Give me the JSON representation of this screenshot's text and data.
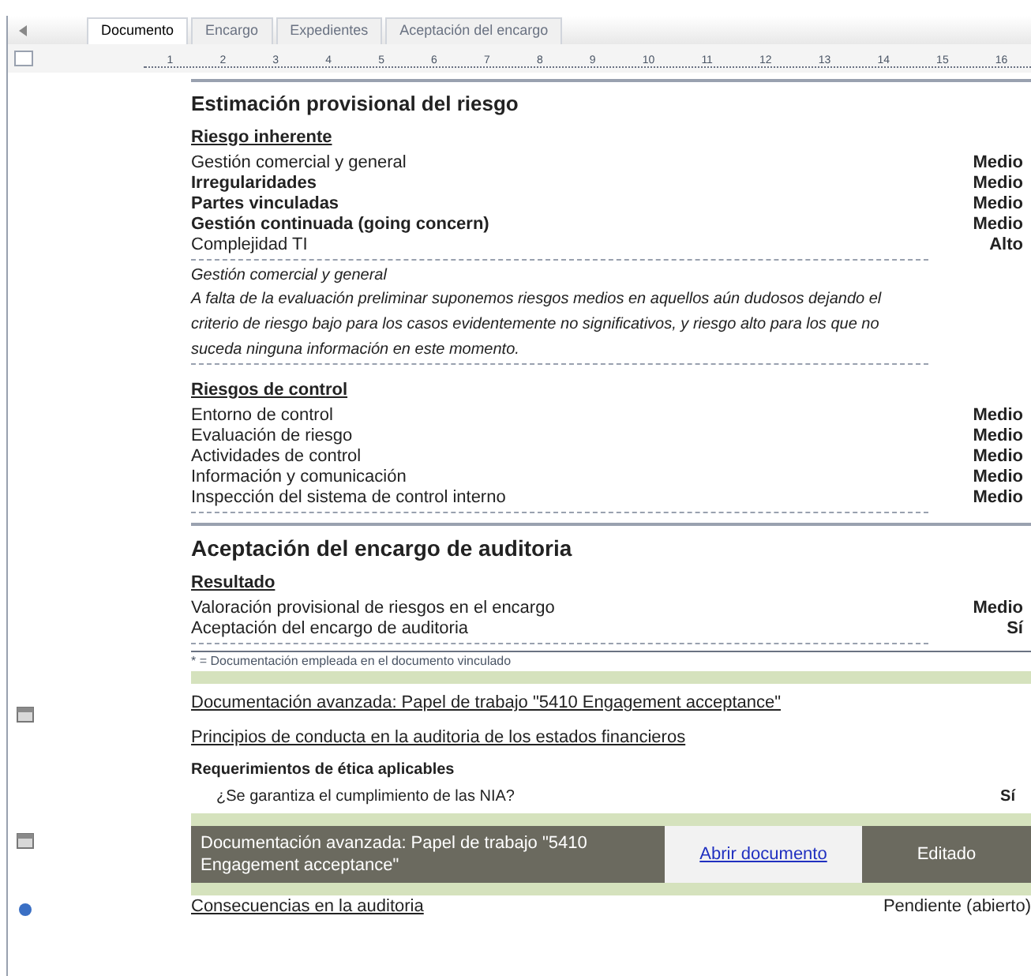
{
  "tabs": [
    {
      "label": "Documento",
      "selected": true
    },
    {
      "label": "Encargo",
      "selected": false
    },
    {
      "label": "Expedientes",
      "selected": false
    },
    {
      "label": "Aceptación del encargo",
      "selected": false
    }
  ],
  "ruler": [
    "1",
    "2",
    "3",
    "4",
    "5",
    "6",
    "7",
    "8",
    "9",
    "10",
    "11",
    "12",
    "13",
    "14",
    "15",
    "16"
  ],
  "risk": {
    "title": "Estimación provisional del riesgo",
    "inherent": {
      "heading": "Riesgo inherente",
      "rows": [
        {
          "label": "Gestión comercial y general",
          "value": "Medio",
          "bold": false
        },
        {
          "label": "Irregularidades",
          "value": "Medio",
          "bold": true
        },
        {
          "label": "Partes vinculadas",
          "value": "Medio",
          "bold": true
        },
        {
          "label": "Gestión continuada (going concern)",
          "value": "Medio",
          "bold": true
        },
        {
          "label": "Complejidad TI",
          "value": "Alto",
          "bold": false
        }
      ]
    },
    "note_title": "Gestión comercial y general",
    "note": "A falta de la evaluación preliminar suponemos riesgos medios en aquellos aún dudosos dejando el criterio de riesgo bajo para los casos evidentemente no significativos, y riesgo alto para los que no suceda ninguna información en este momento.",
    "control": {
      "heading": "Riesgos de control",
      "rows": [
        {
          "label": "Entorno de control",
          "value": "Medio",
          "bold": false
        },
        {
          "label": "Evaluación de riesgo",
          "value": "Medio",
          "bold": false
        },
        {
          "label": "Actividades de control",
          "value": "Medio",
          "bold": false
        },
        {
          "label": "Información y comunicación",
          "value": "Medio",
          "bold": false
        },
        {
          "label": "Inspección del sistema de control interno",
          "value": "Medio",
          "bold": false
        }
      ]
    }
  },
  "acceptance": {
    "title": "Aceptación del encargo de auditoria",
    "heading": "Resultado",
    "rows": [
      {
        "label": "Valoración provisional de riesgos en el encargo",
        "value": "Medio",
        "bold": false
      },
      {
        "label": "Aceptación del encargo de auditoria",
        "value": "Sí",
        "bold": false
      }
    ],
    "footnote": "* = Documentación empleada en el documento vinculado"
  },
  "doc_link": "Documentación avanzada: Papel de trabajo \"5410 Engagement acceptance\"",
  "principles_link": "Principios de conducta en la auditoria de los estados financieros",
  "ethics": {
    "heading": "Requerimientos de ética aplicables",
    "question": "¿Se garantiza el cumplimiento de las NIA?",
    "answer": "Sí"
  },
  "doc_box": {
    "text": "Documentación avanzada: Papel de trabajo \"5410 Engagement acceptance\"",
    "action": "Abrir documento",
    "status": "Editado"
  },
  "consequences": {
    "label": "Consecuencias en la auditoria",
    "value": "Pendiente (abierto)"
  }
}
